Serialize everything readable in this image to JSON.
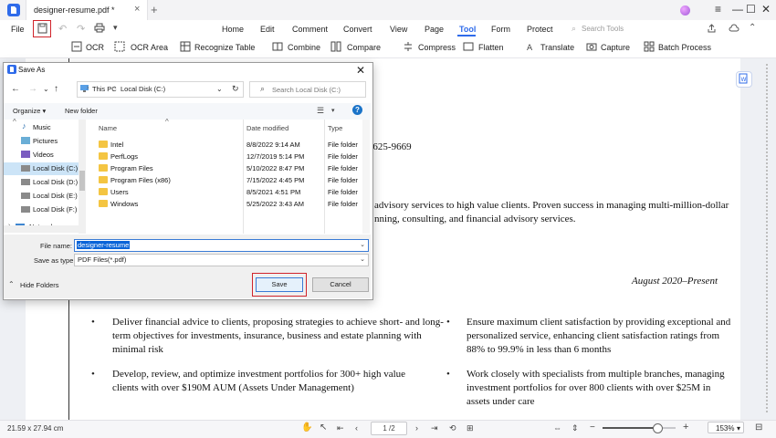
{
  "title_bar": {
    "tab_title": "designer-resume.pdf *",
    "tab_close": "×",
    "add_tab": "+",
    "window_controls": {
      "minimize": "—",
      "maximize": "☐",
      "close": "✕"
    }
  },
  "menubar": {
    "file": "File",
    "items": [
      "Home",
      "Edit",
      "Comment",
      "Convert",
      "View",
      "Page",
      "Tool",
      "Form",
      "Protect"
    ],
    "active": "Tool",
    "search_placeholder": "Search Tools"
  },
  "toolbar": {
    "items": [
      "OCR",
      "OCR Area",
      "Recognize Table",
      "Combine",
      "Compare",
      "Compress",
      "Flatten",
      "Translate",
      "Capture",
      "Batch Process"
    ]
  },
  "document": {
    "phone_fragment": ") 625-9669",
    "summary_line1": "advisory services to high value clients. Proven success in managing multi-million-dollar",
    "summary_line2": "nning, consulting, and financial advisory services.",
    "date_range": "August 2020–Present",
    "bullets_left": [
      [
        "Deliver financial advice to clients, proposing strategies to achieve short- and long-",
        "term objectives for investments, insurance, business and estate planning with",
        "minimal risk"
      ],
      [
        "Develop, review, and optimize investment portfolios for 300+ high value",
        "clients with over $190M AUM (Assets Under Management)"
      ]
    ],
    "bullets_right": [
      [
        "Ensure maximum client satisfaction by providing exceptional and",
        "personalized service, enhancing client satisfaction ratings from",
        "88% to 99.9% in less than 6 months"
      ],
      [
        "Work closely with specialists from multiple branches, managing",
        "investment portfolios for over 800 clients with over $25M in",
        "assets under care"
      ]
    ]
  },
  "statusbar": {
    "page_size": "21.59 x 27.94 cm",
    "page_indicator": "1 /2",
    "zoom": "153%",
    "zoom_fraction": 0.73
  },
  "dialog": {
    "title": "Save As",
    "close": "✕",
    "breadcrumb": [
      "This PC",
      "Local Disk (C:)"
    ],
    "search_placeholder": "Search Local Disk (C:)",
    "organize": "Organize ▾",
    "new_folder": "New folder",
    "nav_items": [
      "Music",
      "Pictures",
      "Videos",
      "Local Disk (C:)",
      "Local Disk (D:)",
      "Local Disk (E:)",
      "Local Disk (F:)",
      "Network"
    ],
    "columns": {
      "name": "Name",
      "date": "Date modified",
      "type": "Type"
    },
    "files": [
      {
        "name": "Intel",
        "date": "8/8/2022 9:14 AM",
        "type": "File folder"
      },
      {
        "name": "PerfLogs",
        "date": "12/7/2019 5:14 PM",
        "type": "File folder"
      },
      {
        "name": "Program Files",
        "date": "5/10/2022 8:47 PM",
        "type": "File folder"
      },
      {
        "name": "Program Files (x86)",
        "date": "7/15/2022 4:45 PM",
        "type": "File folder"
      },
      {
        "name": "Users",
        "date": "8/5/2021 4:51 PM",
        "type": "File folder"
      },
      {
        "name": "Windows",
        "date": "5/25/2022 3:43 AM",
        "type": "File folder"
      }
    ],
    "file_name_label": "File name:",
    "file_name_value": "designer-resume",
    "save_type_label": "Save as type:",
    "save_type_value": "PDF Files(*.pdf)",
    "hide_folders": "Hide Folders",
    "save": "Save",
    "cancel": "Cancel"
  },
  "colors": {
    "accent": "#2f6bea",
    "highlight_border": "#d0242b",
    "selection": "#0a64d8"
  }
}
